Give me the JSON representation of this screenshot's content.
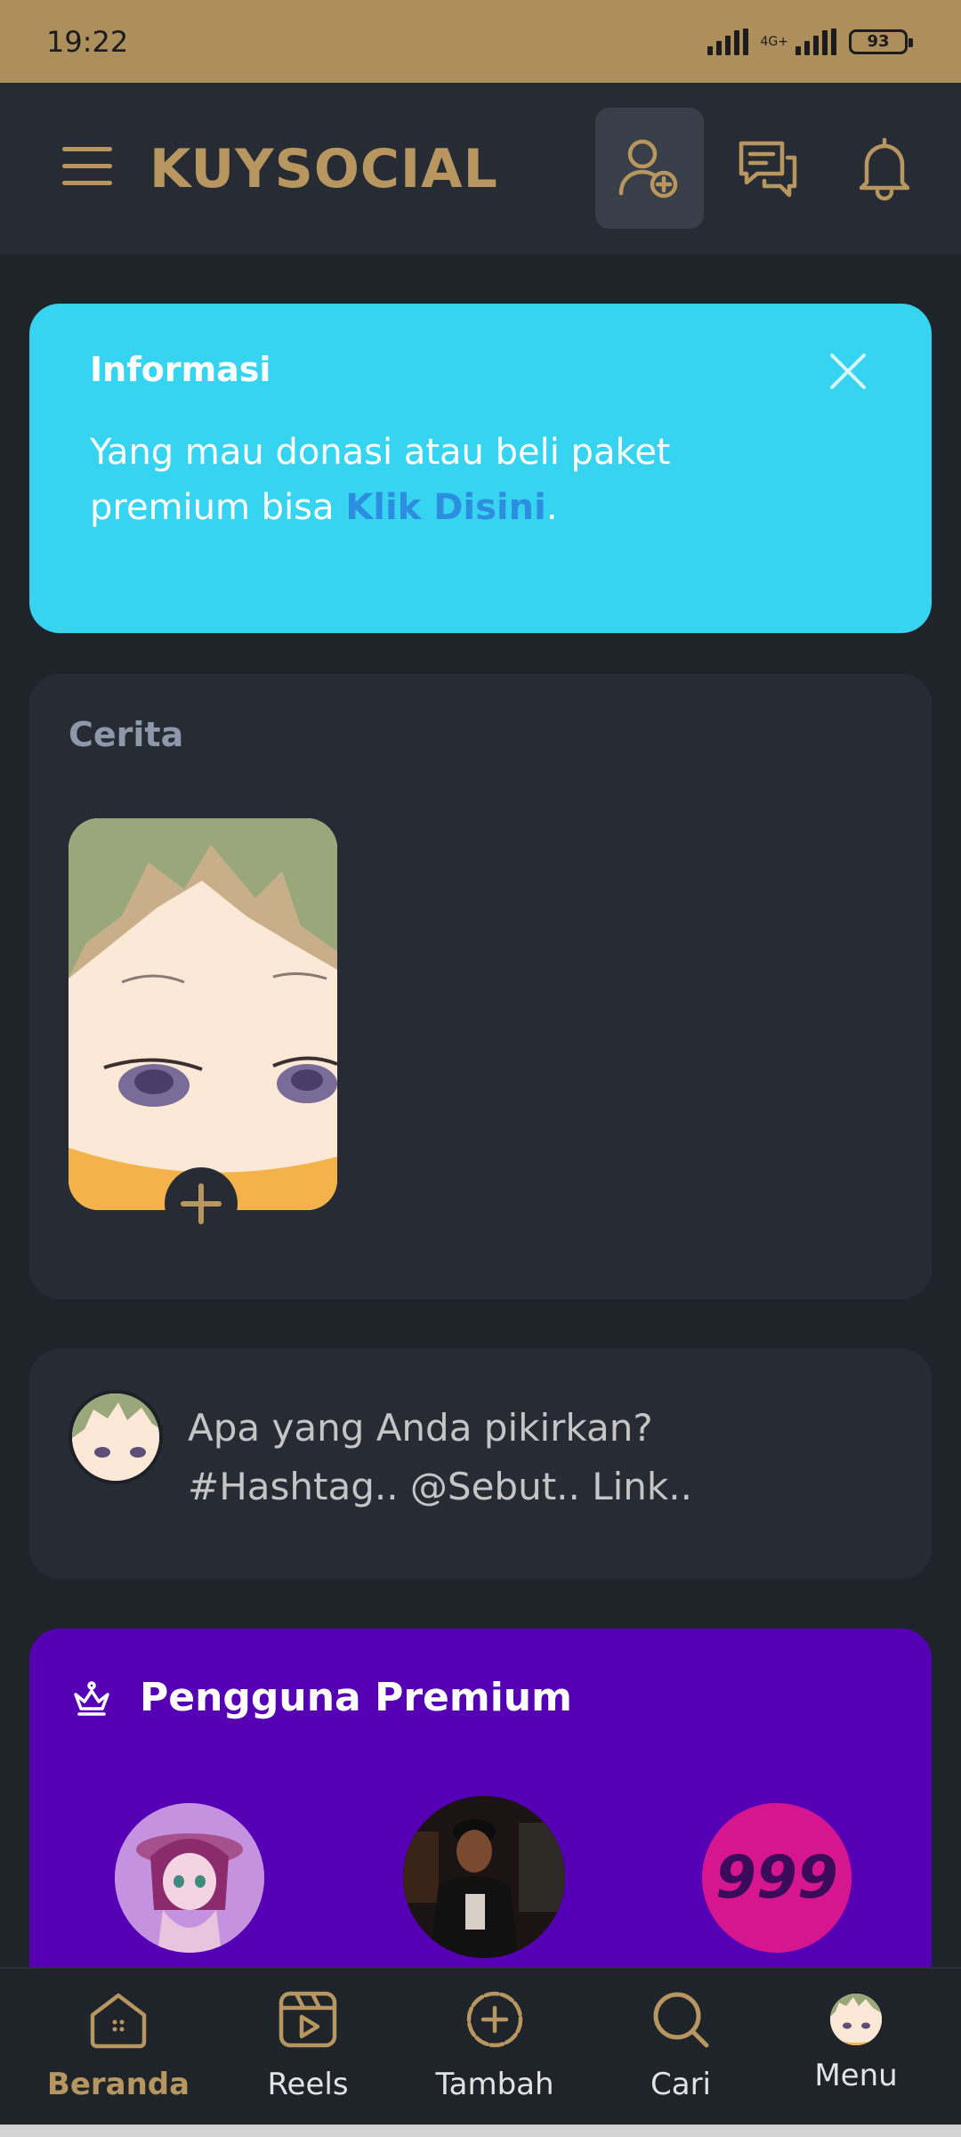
{
  "status_bar": {
    "time": "19:22",
    "network": "4G+",
    "battery": "93"
  },
  "header": {
    "logo": "KUYSOCIAL",
    "icons": [
      "menu-icon",
      "add-friend-icon",
      "chat-icon",
      "bell-icon"
    ]
  },
  "info": {
    "title": "Informasi",
    "text": "Yang mau donasi atau beli paket premium bisa ",
    "link": "Klik Disini",
    "suffix": "."
  },
  "stories": {
    "title": "Cerita"
  },
  "composer": {
    "placeholder_line1": "Apa yang Anda pikirkan?",
    "placeholder_line2": "#Hashtag.. @Sebut.. Link.."
  },
  "premium": {
    "title": "Pengguna Premium"
  },
  "nav": {
    "items": [
      {
        "label": "Beranda",
        "icon": "home-icon",
        "active": true
      },
      {
        "label": "Reels",
        "icon": "reels-icon",
        "active": false
      },
      {
        "label": "Tambah",
        "icon": "add-circle-icon",
        "active": false
      },
      {
        "label": "Cari",
        "icon": "search-icon",
        "active": false
      },
      {
        "label": "Menu",
        "icon": "avatar",
        "active": false
      }
    ]
  },
  "colors": {
    "accent_gold": "#b8965f",
    "info_bg": "#37d4f2",
    "premium_bg": "#5500b5",
    "card_bg": "#272c34"
  }
}
